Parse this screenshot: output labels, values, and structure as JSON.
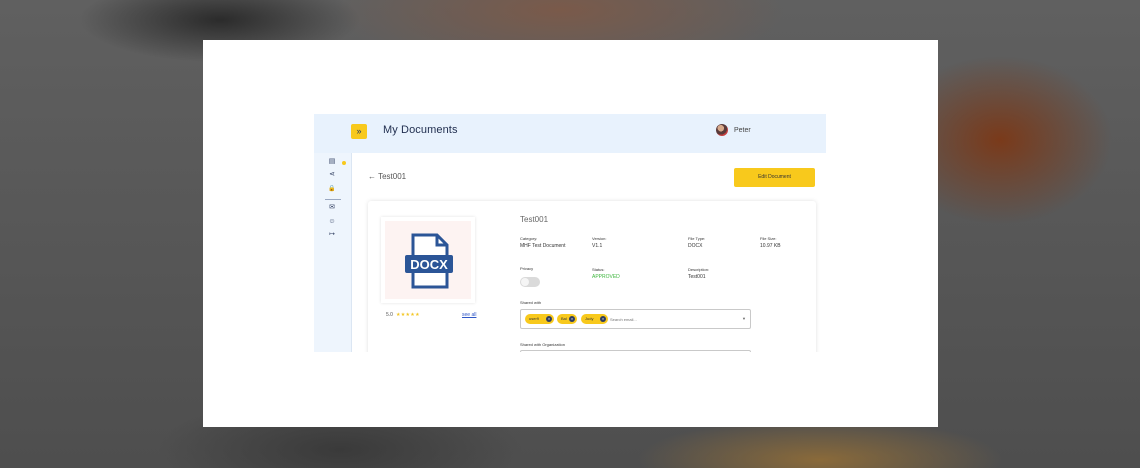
{
  "header": {
    "expand_icon": "»",
    "title": "My Documents",
    "user_name": "Peter"
  },
  "sidebar": {
    "items": [
      {
        "icon": "document-icon",
        "glyph": "▤"
      },
      {
        "icon": "share-icon",
        "glyph": "⋖"
      },
      {
        "icon": "lock-icon",
        "glyph": "🔒"
      },
      {
        "icon": "mail-icon",
        "glyph": "✉"
      },
      {
        "icon": "user-icon",
        "glyph": "☺"
      },
      {
        "icon": "logout-icon",
        "glyph": "↦"
      }
    ]
  },
  "page": {
    "back_label": "← Test001",
    "edit_button": "Edit Document"
  },
  "document": {
    "thumbnail_label": "DOCX",
    "rating": "5.0",
    "stars": "★★★★★",
    "see_all": "see all",
    "title": "Test001",
    "fields": {
      "category_label": "Category:",
      "category_value": "MHF Test Document",
      "version_label": "Version:",
      "version_value": "V1.1",
      "file_type_label": "File Type:",
      "file_type_value": "DOCX",
      "file_size_label": "File Size:",
      "file_size_value": "10.97 KB",
      "privacy_label": "Privacy",
      "privacy_on": false,
      "status_label": "Status:",
      "status_value": "APPROVED",
      "description_label": "Description:",
      "description_value": "Test001"
    },
    "shared_with_label": "Shared with",
    "shared_with": [
      "user9",
      "Bal",
      "Judy"
    ],
    "shared_placeholder": "Search email...",
    "shared_org_label": "Shared with Organization"
  },
  "colors": {
    "accent": "#f8c91c",
    "topbar": "#e8f2fd",
    "status_approved": "#3db63d",
    "docx_blue": "#2b5597"
  }
}
